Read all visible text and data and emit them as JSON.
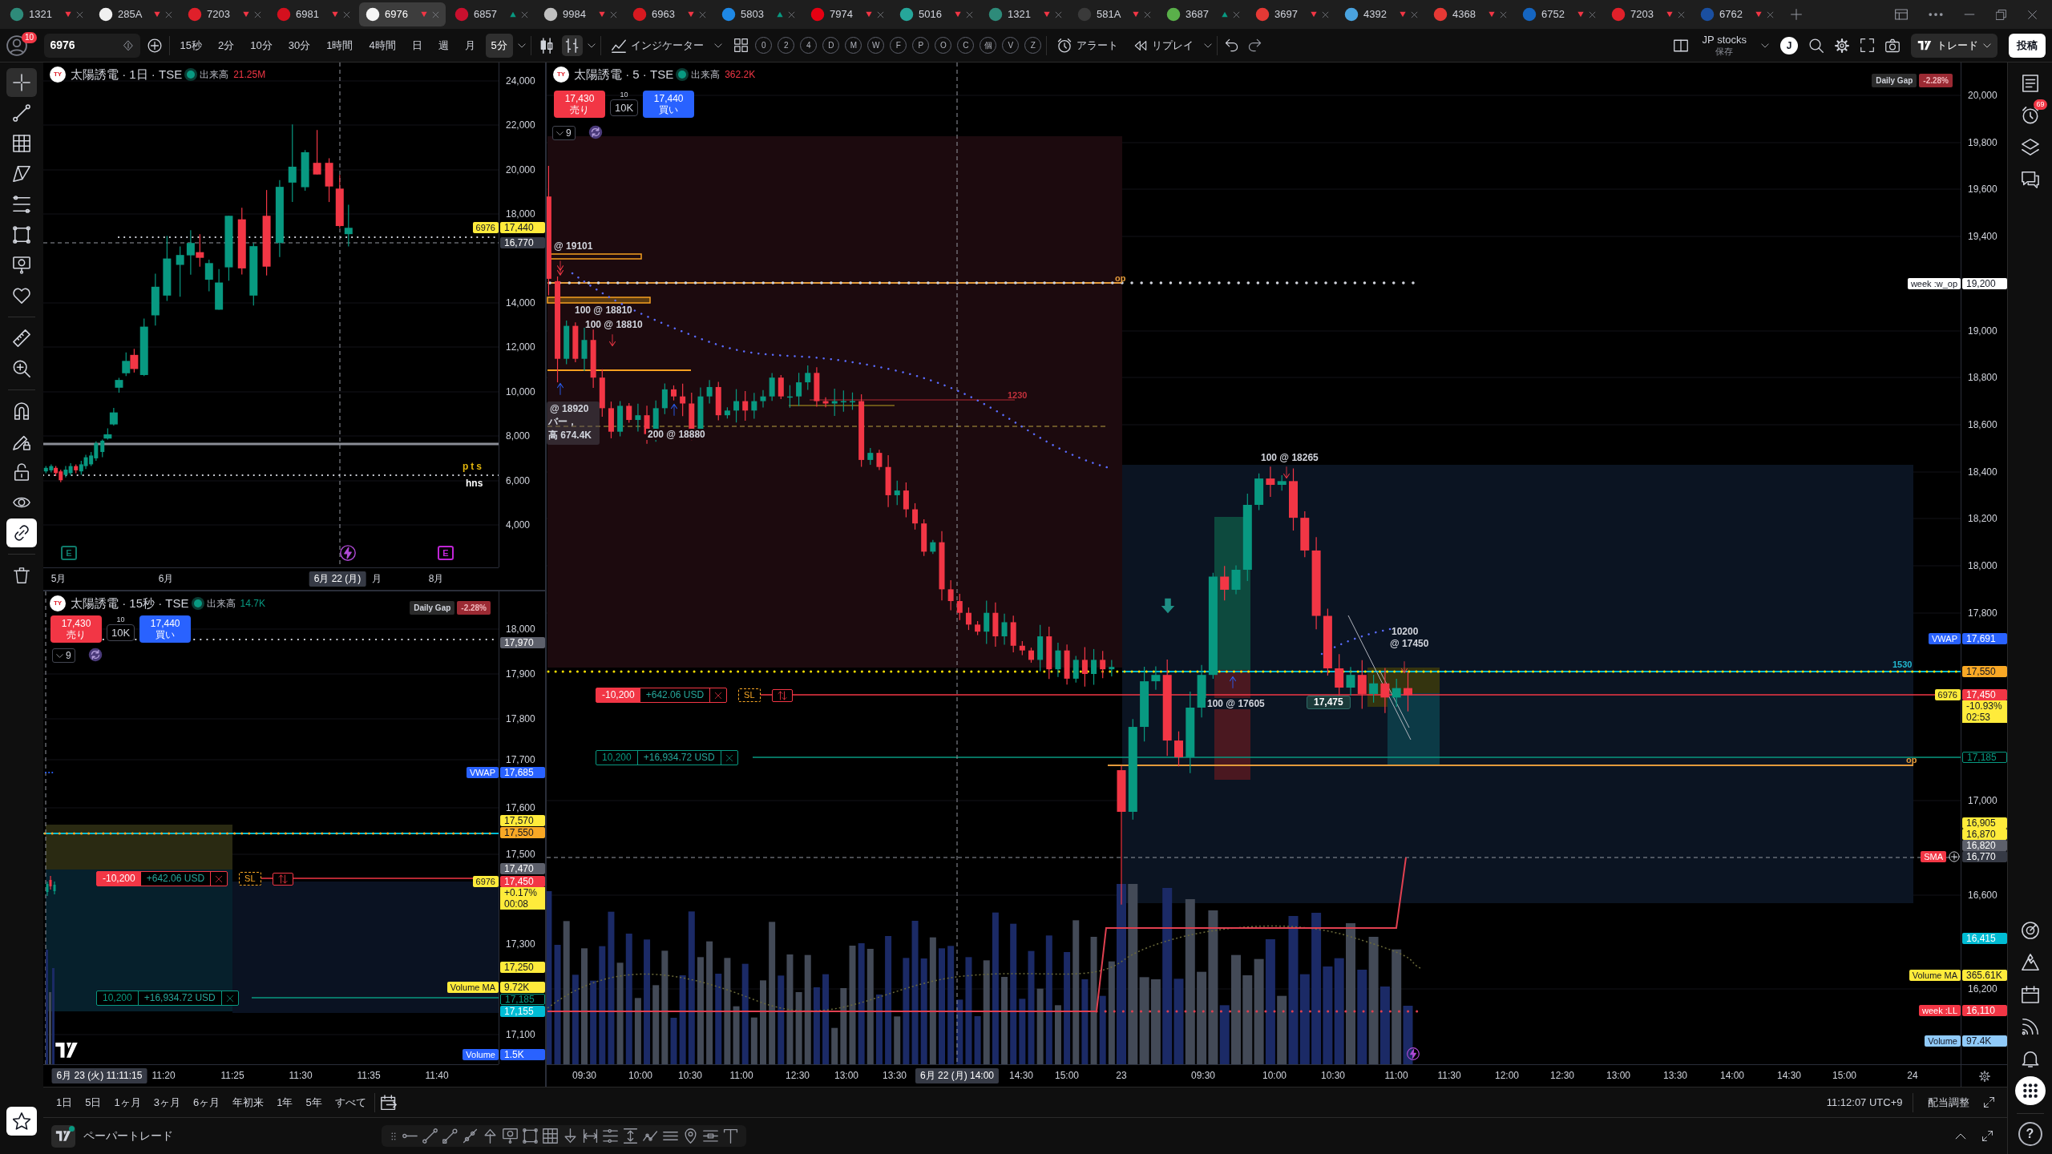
{
  "tabs": [
    {
      "symbol": "1321",
      "rising": false,
      "color": "#2e8b7a",
      "selected": false
    },
    {
      "symbol": "285A",
      "rising": false,
      "color": "#f0f0f0",
      "selected": false
    },
    {
      "symbol": "7203",
      "rising": false,
      "color": "#e0202a",
      "selected": false
    },
    {
      "symbol": "6981",
      "rising": false,
      "color": "#d4101e",
      "selected": false
    },
    {
      "symbol": "6976",
      "rising": false,
      "color": "#f5f5f5",
      "selected": true
    },
    {
      "symbol": "6857",
      "rising": true,
      "color": "#c8102e",
      "selected": false
    },
    {
      "symbol": "9984",
      "rising": false,
      "color": "#c0c0c0",
      "selected": false
    },
    {
      "symbol": "6963",
      "rising": false,
      "color": "#d71920",
      "selected": false
    },
    {
      "symbol": "5803",
      "rising": true,
      "color": "#1e88e5",
      "selected": false
    },
    {
      "symbol": "7974",
      "rising": false,
      "color": "#e60012",
      "selected": false
    },
    {
      "symbol": "5016",
      "rising": false,
      "color": "#26a69a",
      "selected": false
    },
    {
      "symbol": "1321",
      "rising": false,
      "color": "#2e8b7a",
      "selected": false
    },
    {
      "symbol": "581A",
      "rising": false,
      "color": "#3a3a3a",
      "selected": false
    },
    {
      "symbol": "3687",
      "rising": true,
      "color": "#5ab04a",
      "selected": false
    },
    {
      "symbol": "3697",
      "rising": false,
      "color": "#e53935",
      "selected": false
    },
    {
      "symbol": "4392",
      "rising": false,
      "color": "#4aa3df",
      "selected": false
    },
    {
      "symbol": "4368",
      "rising": false,
      "color": "#e53935",
      "selected": false
    },
    {
      "symbol": "6752",
      "rising": false,
      "color": "#1565c0",
      "selected": false
    },
    {
      "symbol": "7203",
      "rising": false,
      "color": "#e0202a",
      "selected": false
    },
    {
      "symbol": "6762",
      "rising": false,
      "color": "#1a4fa0",
      "selected": false
    }
  ],
  "toolbar": {
    "notification_badge": "10",
    "symbol": "6976",
    "intervals": [
      {
        "label": "15秒",
        "selected": false
      },
      {
        "label": "2分",
        "selected": false
      },
      {
        "label": "10分",
        "selected": false
      },
      {
        "label": "30分",
        "selected": false
      },
      {
        "label": "1時間",
        "selected": false
      },
      {
        "label": "4時間",
        "selected": false
      },
      {
        "label": "日",
        "selected": false
      },
      {
        "label": "週",
        "selected": false
      },
      {
        "label": "月",
        "selected": false
      },
      {
        "label": "5分",
        "selected": true
      }
    ],
    "indicators": "インジケーター",
    "sessions": [
      "0",
      "2",
      "4",
      "D",
      "M",
      "W",
      "F",
      "P",
      "O",
      "C",
      "個",
      "V",
      "Z"
    ],
    "alert": "アラート",
    "replay": "リプレイ",
    "layout_name": "JP stocks",
    "layout_status": "保存",
    "avatar": "J",
    "trade": "トレード",
    "publish": "投稿"
  },
  "left_toolbar": {
    "tools": [
      {
        "kind": "crosshair",
        "selected": true
      },
      {
        "kind": "trend-line",
        "selected": false
      },
      {
        "kind": "grid",
        "selected": false
      },
      {
        "kind": "pattern",
        "selected": false
      },
      {
        "kind": "fib",
        "selected": false
      },
      {
        "kind": "rectangle",
        "selected": false
      },
      {
        "kind": "price-note",
        "selected": false
      },
      {
        "kind": "heart",
        "selected": false
      },
      {
        "kind": "ruler",
        "selected": false
      },
      {
        "kind": "zoom",
        "selected": false
      }
    ],
    "toggles": [
      {
        "kind": "magnet",
        "on": false
      },
      {
        "kind": "pencil-lock",
        "on": false
      },
      {
        "kind": "lock",
        "on": false
      },
      {
        "kind": "eye",
        "on": false
      },
      {
        "kind": "link",
        "on": true
      }
    ]
  },
  "charts": [
    {
      "logo": "TY",
      "title": "太陽誘電 · 1日 · TSE",
      "market_open": true,
      "volume_label": "出来高",
      "volume": "21.25M",
      "volume_rising": false,
      "price_axis": [
        "24,000",
        "22,000",
        "20,000",
        "18,000",
        "14,000",
        "12,000",
        "10,000",
        "8,000",
        "6,000",
        "4,000"
      ],
      "price_tags": [
        {
          "kind": "filled",
          "label": {
            "text": "6976",
            "color": "#ffeb3b"
          },
          "text": "17,440",
          "color": "#ffeb3b"
        },
        {
          "kind": "filled",
          "text": "16,770",
          "color": "#363a45"
        }
      ],
      "chart_labels": [
        {
          "text": "pts",
          "color": "#e1b40c"
        },
        {
          "text": "hns",
          "color": "#ffffff"
        }
      ],
      "events": [
        {
          "kind": "earnings",
          "text": "E"
        },
        {
          "kind": "flash"
        },
        {
          "kind": "dividend",
          "text": "E"
        }
      ],
      "time_axis": [
        {
          "kind": "tick",
          "text": "5月"
        },
        {
          "kind": "tick",
          "text": "6月"
        },
        {
          "kind": "crosshair",
          "text": "6月 22 (月)"
        },
        {
          "kind": "tick",
          "text": "月"
        },
        {
          "kind": "tick",
          "text": "8月"
        }
      ]
    },
    {
      "logo": "TY",
      "title": "太陽誘電 · 15秒 · TSE",
      "market_open": true,
      "volume_label": "出来高",
      "volume": "14.7K",
      "volume_rising": true,
      "daily_gap": {
        "label": "Daily Gap",
        "value": "-2.28%"
      },
      "order_panel": {
        "sell_price": "17,430",
        "sell_label": "売り",
        "qty_step": "10",
        "qty": "10K",
        "buy_price": "17,440",
        "buy_label": "買い"
      },
      "indicators": "9",
      "price_axis": [
        "18,000",
        "17,900",
        "17,800",
        "17,700",
        "17,600",
        "17,500",
        "17,300",
        "17,100"
      ],
      "price_tags": [
        {
          "kind": "filled",
          "text": "17,970",
          "color": "#5d606b"
        },
        {
          "kind": "filled",
          "label": {
            "text": "VWAP",
            "color": "#2962ff"
          },
          "text": "17,685",
          "color": "#2962ff"
        },
        {
          "kind": "filled",
          "text": "17,570",
          "color": "#ffeb3b"
        },
        {
          "kind": "filled",
          "text": "17,550",
          "color": "#f9a825"
        },
        {
          "kind": "filled",
          "text": "17,470",
          "color": "#5d606b"
        },
        {
          "kind": "filled",
          "label": {
            "text": "6976",
            "color": "#ffeb3b"
          },
          "text": "17,450",
          "color": "#f23645",
          "sub": {
            "texts": [
              "+0.17%",
              "00:08"
            ],
            "color": "#ffeb3b"
          }
        },
        {
          "kind": "filled",
          "text": "17,250",
          "color": "#ffeb3b"
        },
        {
          "kind": "filled",
          "label": {
            "text": "Volume MA",
            "color": "#ffeb3b"
          },
          "text": "9.72K",
          "color": "#ffeb3b"
        },
        {
          "kind": "outline",
          "text": "17,185",
          "color": "#089981"
        },
        {
          "kind": "filled",
          "text": "17,155",
          "color": "#00bcd4"
        },
        {
          "kind": "filled",
          "label": {
            "text": "Volume",
            "color": "#2962ff"
          },
          "text": "1.5K",
          "color": "#2962ff"
        }
      ],
      "positions": [
        {
          "kind": "short",
          "quantity": "-10,200",
          "pnl": "+642.06 USD",
          "stop": "SL"
        },
        {
          "kind": "long",
          "quantity": "10,200",
          "pnl": "+16,934.72 USD"
        }
      ],
      "time_axis": [
        {
          "kind": "crosshair",
          "text": "6月 23 (火) 11:11:15"
        },
        {
          "kind": "tick",
          "text": "11:20"
        },
        {
          "kind": "tick",
          "text": "11:25"
        },
        {
          "kind": "tick",
          "text": "11:30"
        },
        {
          "kind": "tick",
          "text": "11:35"
        },
        {
          "kind": "tick",
          "text": "11:40"
        }
      ]
    },
    {
      "logo": "TY",
      "title": "太陽誘電 · 5 · TSE",
      "market_open": true,
      "volume_label": "出来高",
      "volume": "362.2K",
      "volume_rising": false,
      "daily_gap": {
        "label": "Daily Gap",
        "value": "-2.28%"
      },
      "order_panel": {
        "sell_price": "17,430",
        "sell_label": "売り",
        "qty_step": "10",
        "qty": "10K",
        "buy_price": "17,440",
        "buy_label": "買い"
      },
      "indicators": "9",
      "price_axis": [
        "20,000",
        "19,800",
        "19,600",
        "19,400",
        "19,000",
        "18,800",
        "18,600",
        "18,400",
        "18,200",
        "18,000",
        "17,800",
        "17,000",
        "16,600",
        "16,200"
      ],
      "price_tags": [
        {
          "kind": "filled",
          "label": {
            "text": "week :w_op",
            "color": "#ffffff"
          },
          "text": "19,200",
          "color": "#ffffff"
        },
        {
          "kind": "filled",
          "label": {
            "text": "VWAP",
            "color": "#2962ff"
          },
          "text": "17,691",
          "color": "#2962ff"
        },
        {
          "kind": "filled",
          "text": "17,550",
          "color": "#f9a825"
        },
        {
          "kind": "filled",
          "label": {
            "text": "6976",
            "color": "#ffeb3b"
          },
          "text": "17,450",
          "color": "#f23645",
          "sub": {
            "texts": [
              "-10.93%",
              "02:53"
            ],
            "color": "#ffeb3b"
          }
        },
        {
          "kind": "outline",
          "text": "17,185",
          "color": "#089981"
        },
        {
          "kind": "filled",
          "text": "16,905",
          "color": "#ffeb3b"
        },
        {
          "kind": "filled",
          "text": "16,870",
          "color": "#ffeb3b"
        },
        {
          "kind": "filled",
          "text": "16,820",
          "color": "#5d606b"
        },
        {
          "kind": "crosshair",
          "label": {
            "text": "SMA",
            "color": "#f23645"
          },
          "text": "16,770",
          "color": "#363a45"
        },
        {
          "kind": "filled",
          "text": "16,415",
          "color": "#00bcd4"
        },
        {
          "kind": "filled",
          "label": {
            "text": "Volume MA",
            "color": "#ffeb3b"
          },
          "text": "365.61K",
          "color": "#ffeb3b"
        },
        {
          "kind": "filled",
          "label": {
            "text": "week :LL",
            "color": "#f23645"
          },
          "text": "16,110",
          "color": "#f23645"
        },
        {
          "kind": "filled",
          "label": {
            "text": "Volume",
            "color": "#90caf9"
          },
          "text": "97.4K",
          "color": "#90caf9"
        }
      ],
      "annotations": [
        {
          "text": "@ 19101",
          "color": "#d1d4dc"
        },
        {
          "text": "100 @ 18810",
          "color": "#d1d4dc"
        },
        {
          "text": "100 @ 18810",
          "color": "#d1d4dc"
        },
        {
          "text": "@ 18920",
          "color": "#d1d4dc"
        },
        {
          "text": "バー，",
          "color": "#d1d4dc"
        },
        {
          "text": "高 674.4K",
          "color": "#d1d4dc"
        },
        {
          "text": "200 @ 18880",
          "color": "#d1d4dc"
        },
        {
          "text": "1230",
          "color": "#c2313c"
        },
        {
          "text": "op",
          "color": "#e39a3b"
        },
        {
          "text": "100 @ 18265",
          "color": "#d1d4dc"
        },
        {
          "text": "10200",
          "color": "#d1d4dc"
        },
        {
          "text": "@ 17450",
          "color": "#d1d4dc"
        },
        {
          "text": "100 @ 17605",
          "color": "#d1d4dc"
        },
        {
          "text": "1530",
          "color": "#22b8d0"
        },
        {
          "text": "op",
          "color": "#e39a3b"
        }
      ],
      "markers": [
        {
          "kind": "sell-double"
        },
        {
          "kind": "buy"
        },
        {
          "kind": "sell"
        },
        {
          "kind": "buy"
        },
        {
          "kind": "signal"
        },
        {
          "kind": "buy"
        },
        {
          "kind": "sell"
        },
        {
          "kind": "sell"
        }
      ],
      "price_badge": "17,475",
      "positions": [
        {
          "kind": "short",
          "quantity": "-10,200",
          "pnl": "+642.06 USD",
          "stop": "SL"
        },
        {
          "kind": "long",
          "quantity": "10,200",
          "pnl": "+16,934.72 USD"
        }
      ],
      "events": [
        {
          "kind": "flash"
        }
      ],
      "time_axis": [
        {
          "kind": "tick",
          "text": "09:30"
        },
        {
          "kind": "tick",
          "text": "10:00"
        },
        {
          "kind": "tick",
          "text": "10:30"
        },
        {
          "kind": "tick",
          "text": "11:00"
        },
        {
          "kind": "tick",
          "text": "12:30"
        },
        {
          "kind": "tick",
          "text": "13:00"
        },
        {
          "kind": "tick",
          "text": "13:30"
        },
        {
          "kind": "crosshair",
          "text": "6月 22 (月) 14:00"
        },
        {
          "kind": "tick",
          "text": "14:30"
        },
        {
          "kind": "tick",
          "text": "15:00"
        },
        {
          "kind": "tick",
          "text": "23"
        },
        {
          "kind": "tick",
          "text": "09:30"
        },
        {
          "kind": "tick",
          "text": "10:00"
        },
        {
          "kind": "tick",
          "text": "10:30"
        },
        {
          "kind": "tick",
          "text": "11:00"
        },
        {
          "kind": "tick",
          "text": "11:30"
        },
        {
          "kind": "tick",
          "text": "12:00"
        },
        {
          "kind": "tick",
          "text": "12:30"
        },
        {
          "kind": "tick",
          "text": "13:00"
        },
        {
          "kind": "tick",
          "text": "13:30"
        },
        {
          "kind": "tick",
          "text": "14:00"
        },
        {
          "kind": "tick",
          "text": "14:30"
        },
        {
          "kind": "tick",
          "text": "15:00"
        },
        {
          "kind": "tick",
          "text": "24"
        }
      ]
    }
  ],
  "range_bar": {
    "ranges": [
      "1日",
      "5日",
      "1ヶ月",
      "3ヶ月",
      "6ヶ月",
      "年初来",
      "1年",
      "5年",
      "すべて"
    ],
    "clock": "11:12:07 UTC+9",
    "adjust": "配当調整"
  },
  "bottom_bar": {
    "title": "ペーパートレード"
  },
  "right_sidebar": {
    "alerts_badge": "69",
    "help": "?"
  }
}
